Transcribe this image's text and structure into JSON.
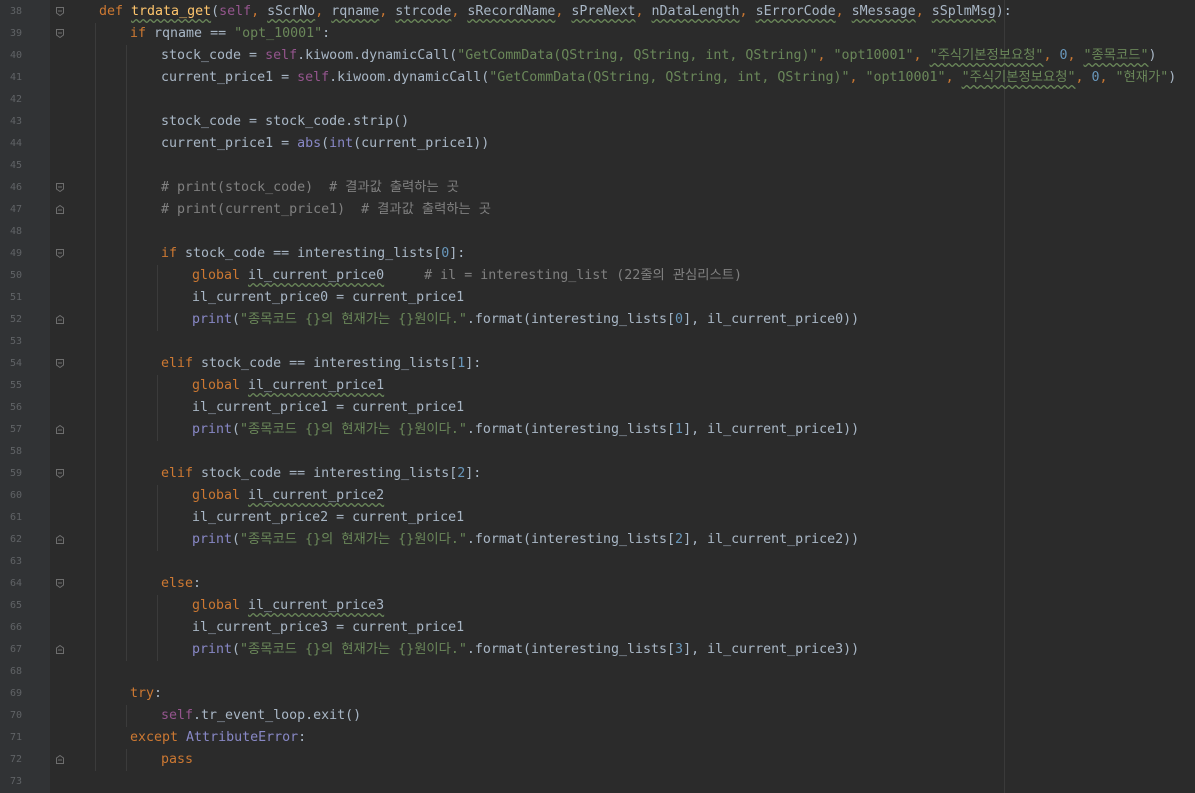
{
  "editor": {
    "colors": {
      "background": "#2b2b2b",
      "gutter": "#313335",
      "keyword": "#cc7832",
      "function": "#ffc66d",
      "string": "#6a8759",
      "number": "#6897bb",
      "comment": "#808080",
      "self": "#94558d",
      "text": "#a9b7c6"
    },
    "lines": [
      {
        "num": "38",
        "indent": 1,
        "fold": "open",
        "tokens": [
          {
            "t": "def ",
            "c": "kw"
          },
          {
            "t": "trdata_get",
            "c": "fn",
            "u": true
          },
          {
            "t": "(",
            "c": "plain"
          },
          {
            "t": "self",
            "c": "self"
          },
          {
            "t": ", ",
            "c": "pun"
          },
          {
            "t": "sScrNo",
            "c": "param",
            "u": true
          },
          {
            "t": ", ",
            "c": "pun"
          },
          {
            "t": "rqname",
            "c": "param",
            "u": true
          },
          {
            "t": ", ",
            "c": "pun"
          },
          {
            "t": "strcode",
            "c": "param",
            "u": true
          },
          {
            "t": ", ",
            "c": "pun"
          },
          {
            "t": "sRecordName",
            "c": "param",
            "u": true
          },
          {
            "t": ", ",
            "c": "pun"
          },
          {
            "t": "sPreNext",
            "c": "param",
            "u": true
          },
          {
            "t": ", ",
            "c": "pun"
          },
          {
            "t": "nDataLength",
            "c": "param",
            "u": true
          },
          {
            "t": ", ",
            "c": "pun"
          },
          {
            "t": "sErrorCode",
            "c": "param",
            "u": true
          },
          {
            "t": ", ",
            "c": "pun"
          },
          {
            "t": "sMessage",
            "c": "param",
            "u": true
          },
          {
            "t": ", ",
            "c": "pun"
          },
          {
            "t": "sSplmMsg",
            "c": "param",
            "u": true
          },
          {
            "t": "):",
            "c": "plain"
          }
        ]
      },
      {
        "num": "39",
        "indent": 2,
        "fold": "open",
        "tokens": [
          {
            "t": "if ",
            "c": "kw"
          },
          {
            "t": "rqname == ",
            "c": "plain"
          },
          {
            "t": "\"opt_10001\"",
            "c": "str"
          },
          {
            "t": ":",
            "c": "plain"
          }
        ]
      },
      {
        "num": "40",
        "indent": 3,
        "tokens": [
          {
            "t": "stock_code = ",
            "c": "plain"
          },
          {
            "t": "self",
            "c": "self"
          },
          {
            "t": ".kiwoom.dynamicCall(",
            "c": "plain"
          },
          {
            "t": "\"GetCommData(QString, QString, int, QString)\"",
            "c": "str"
          },
          {
            "t": ", ",
            "c": "pun"
          },
          {
            "t": "\"opt10001\"",
            "c": "str"
          },
          {
            "t": ", ",
            "c": "pun"
          },
          {
            "t": "\"주식기본정보요청\"",
            "c": "str",
            "u": true
          },
          {
            "t": ", ",
            "c": "pun"
          },
          {
            "t": "0",
            "c": "num"
          },
          {
            "t": ", ",
            "c": "pun"
          },
          {
            "t": "\"종목코드\"",
            "c": "str",
            "u": true
          },
          {
            "t": ")",
            "c": "plain"
          }
        ]
      },
      {
        "num": "41",
        "indent": 3,
        "tokens": [
          {
            "t": "current_price1 = ",
            "c": "plain"
          },
          {
            "t": "self",
            "c": "self"
          },
          {
            "t": ".kiwoom.dynamicCall(",
            "c": "plain"
          },
          {
            "t": "\"GetCommData(QString, QString, int, QString)\"",
            "c": "str"
          },
          {
            "t": ", ",
            "c": "pun"
          },
          {
            "t": "\"opt10001\"",
            "c": "str"
          },
          {
            "t": ", ",
            "c": "pun"
          },
          {
            "t": "\"주식기본정보요청\"",
            "c": "str",
            "u": true
          },
          {
            "t": ", ",
            "c": "pun"
          },
          {
            "t": "0",
            "c": "num"
          },
          {
            "t": ", ",
            "c": "pun"
          },
          {
            "t": "\"현재가\"",
            "c": "str"
          },
          {
            "t": ")",
            "c": "plain"
          }
        ]
      },
      {
        "num": "42",
        "indent": 3,
        "tokens": []
      },
      {
        "num": "43",
        "indent": 3,
        "tokens": [
          {
            "t": "stock_code = stock_code.strip()",
            "c": "plain"
          }
        ]
      },
      {
        "num": "44",
        "indent": 3,
        "tokens": [
          {
            "t": "current_price1 = ",
            "c": "plain"
          },
          {
            "t": "abs",
            "c": "bi"
          },
          {
            "t": "(",
            "c": "plain"
          },
          {
            "t": "int",
            "c": "bi"
          },
          {
            "t": "(current_price1))",
            "c": "plain"
          }
        ]
      },
      {
        "num": "45",
        "indent": 3,
        "tokens": []
      },
      {
        "num": "46",
        "indent": 3,
        "fold": "open",
        "tokens": [
          {
            "t": "# print(stock_code)  # 결과값 출력하는 곳",
            "c": "cmt"
          }
        ]
      },
      {
        "num": "47",
        "indent": 3,
        "fold": "close",
        "tokens": [
          {
            "t": "# print(current_price1)  # 결과값 출력하는 곳",
            "c": "cmt"
          }
        ]
      },
      {
        "num": "48",
        "indent": 3,
        "tokens": []
      },
      {
        "num": "49",
        "indent": 3,
        "fold": "open",
        "tokens": [
          {
            "t": "if ",
            "c": "kw"
          },
          {
            "t": "stock_code == interesting_lists[",
            "c": "plain"
          },
          {
            "t": "0",
            "c": "num"
          },
          {
            "t": "]:",
            "c": "plain"
          }
        ]
      },
      {
        "num": "50",
        "indent": 4,
        "tokens": [
          {
            "t": "global ",
            "c": "kw"
          },
          {
            "t": "il_current_price0",
            "c": "plain",
            "u": true
          },
          {
            "t": "     # il = interesting_list (22줄의 관심리스트)",
            "c": "cmt"
          }
        ]
      },
      {
        "num": "51",
        "indent": 4,
        "tokens": [
          {
            "t": "il_current_price0 = current_price1",
            "c": "plain"
          }
        ]
      },
      {
        "num": "52",
        "indent": 4,
        "fold": "close",
        "tokens": [
          {
            "t": "print",
            "c": "bi"
          },
          {
            "t": "(",
            "c": "plain"
          },
          {
            "t": "\"종목코드 {}의 현재가는 {}원이다.\"",
            "c": "str"
          },
          {
            "t": ".format(interesting_lists[",
            "c": "plain"
          },
          {
            "t": "0",
            "c": "num"
          },
          {
            "t": "], il_current_price0))",
            "c": "plain"
          }
        ]
      },
      {
        "num": "53",
        "indent": 3,
        "tokens": []
      },
      {
        "num": "54",
        "indent": 3,
        "fold": "open",
        "tokens": [
          {
            "t": "elif ",
            "c": "kw"
          },
          {
            "t": "stock_code == interesting_lists[",
            "c": "plain"
          },
          {
            "t": "1",
            "c": "num"
          },
          {
            "t": "]:",
            "c": "plain"
          }
        ]
      },
      {
        "num": "55",
        "indent": 4,
        "tokens": [
          {
            "t": "global ",
            "c": "kw"
          },
          {
            "t": "il_current_price1",
            "c": "plain",
            "u": true
          }
        ]
      },
      {
        "num": "56",
        "indent": 4,
        "tokens": [
          {
            "t": "il_current_price1 = current_price1",
            "c": "plain"
          }
        ]
      },
      {
        "num": "57",
        "indent": 4,
        "fold": "close",
        "tokens": [
          {
            "t": "print",
            "c": "bi"
          },
          {
            "t": "(",
            "c": "plain"
          },
          {
            "t": "\"종목코드 {}의 현재가는 {}원이다.\"",
            "c": "str"
          },
          {
            "t": ".format(interesting_lists[",
            "c": "plain"
          },
          {
            "t": "1",
            "c": "num"
          },
          {
            "t": "], il_current_price1))",
            "c": "plain"
          }
        ]
      },
      {
        "num": "58",
        "indent": 3,
        "tokens": []
      },
      {
        "num": "59",
        "indent": 3,
        "fold": "open",
        "tokens": [
          {
            "t": "elif ",
            "c": "kw"
          },
          {
            "t": "stock_code == interesting_lists[",
            "c": "plain"
          },
          {
            "t": "2",
            "c": "num"
          },
          {
            "t": "]:",
            "c": "plain"
          }
        ]
      },
      {
        "num": "60",
        "indent": 4,
        "tokens": [
          {
            "t": "global ",
            "c": "kw"
          },
          {
            "t": "il_current_price2",
            "c": "plain",
            "u": true
          }
        ]
      },
      {
        "num": "61",
        "indent": 4,
        "tokens": [
          {
            "t": "il_current_price2 = current_price1",
            "c": "plain"
          }
        ]
      },
      {
        "num": "62",
        "indent": 4,
        "fold": "close",
        "tokens": [
          {
            "t": "print",
            "c": "bi"
          },
          {
            "t": "(",
            "c": "plain"
          },
          {
            "t": "\"종목코드 {}의 현재가는 {}원이다.\"",
            "c": "str"
          },
          {
            "t": ".format(interesting_lists[",
            "c": "plain"
          },
          {
            "t": "2",
            "c": "num"
          },
          {
            "t": "], il_current_price2))",
            "c": "plain"
          }
        ]
      },
      {
        "num": "63",
        "indent": 3,
        "tokens": []
      },
      {
        "num": "64",
        "indent": 3,
        "fold": "open",
        "tokens": [
          {
            "t": "else",
            "c": "kw"
          },
          {
            "t": ":",
            "c": "plain"
          }
        ]
      },
      {
        "num": "65",
        "indent": 4,
        "tokens": [
          {
            "t": "global ",
            "c": "kw"
          },
          {
            "t": "il_current_price3",
            "c": "plain",
            "u": true
          }
        ]
      },
      {
        "num": "66",
        "indent": 4,
        "tokens": [
          {
            "t": "il_current_price3 = current_price1",
            "c": "plain"
          }
        ]
      },
      {
        "num": "67",
        "indent": 4,
        "fold": "close",
        "tokens": [
          {
            "t": "print",
            "c": "bi"
          },
          {
            "t": "(",
            "c": "plain"
          },
          {
            "t": "\"종목코드 {}의 현재가는 {}원이다.\"",
            "c": "str"
          },
          {
            "t": ".format(interesting_lists[",
            "c": "plain"
          },
          {
            "t": "3",
            "c": "num"
          },
          {
            "t": "], il_current_price3))",
            "c": "plain"
          }
        ]
      },
      {
        "num": "68",
        "indent": 2,
        "tokens": []
      },
      {
        "num": "69",
        "indent": 2,
        "tokens": [
          {
            "t": "try",
            "c": "kw"
          },
          {
            "t": ":",
            "c": "plain"
          }
        ]
      },
      {
        "num": "70",
        "indent": 3,
        "tokens": [
          {
            "t": "self",
            "c": "self"
          },
          {
            "t": ".tr_event_loop.exit()",
            "c": "plain"
          }
        ]
      },
      {
        "num": "71",
        "indent": 2,
        "tokens": [
          {
            "t": "except ",
            "c": "kw"
          },
          {
            "t": "AttributeError",
            "c": "bi"
          },
          {
            "t": ":",
            "c": "plain"
          }
        ]
      },
      {
        "num": "72",
        "indent": 3,
        "fold": "close",
        "tokens": [
          {
            "t": "pass",
            "c": "kw"
          }
        ]
      },
      {
        "num": "73",
        "indent": 0,
        "tokens": []
      }
    ]
  }
}
